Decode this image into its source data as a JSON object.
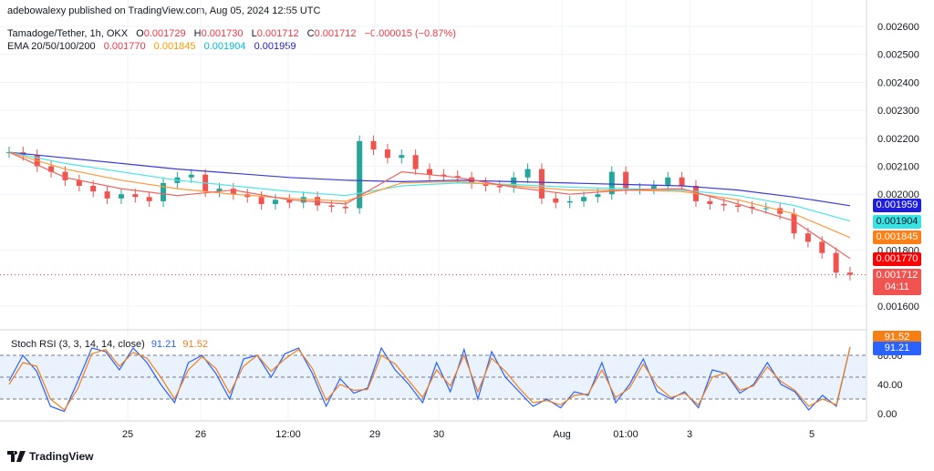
{
  "header": {
    "published": "adebowalexy published on TradingView.com, Aug 05, 2024 12:55 UTC",
    "symbol": "Tamadoge/Tether, 1h, OKX",
    "o_label": "O",
    "o": "0.001729",
    "h_label": "H",
    "h": "0.001730",
    "l_label": "L",
    "l": "0.001712",
    "c_label": "C",
    "c": "0.001712",
    "change": "−0.000015 (−0.87%)",
    "ema_label": "EMA 20/50/100/200",
    "ema20": "0.001770",
    "ema50": "0.001845",
    "ema100": "0.001904",
    "ema200": "0.001959"
  },
  "price_tags": {
    "ema200": "0.001959",
    "ema100": "0.001904",
    "ema50": "0.001845",
    "ema20": "0.001770",
    "last": "0.001712",
    "countdown": "04:11"
  },
  "rsi": {
    "title": "Stoch RSI (3, 3, 14, 14, close)",
    "k": "91.21",
    "d": "91.52",
    "tag_k": "91.21",
    "tag_d": "91.52"
  },
  "branding": "TradingView",
  "chart_data": [
    {
      "type": "candlestick",
      "title": "Tamadoge/Tether, 1h, OKX",
      "y_ticks": [
        "0.002600",
        "0.002500",
        "0.002400",
        "0.002300",
        "0.002200",
        "0.002100",
        "0.002000",
        "0.001800",
        "0.001600"
      ],
      "ylim": [
        0.00155,
        0.00264
      ],
      "x_ticks": [
        "25",
        "26",
        "12:00",
        "29",
        "30",
        "Aug",
        "01:00",
        "3",
        "5"
      ],
      "last_close": 0.001712,
      "series": [
        {
          "name": "EMA 200",
          "color": "#3b3bd8",
          "values": [
            0.00215,
            0.00213,
            0.00211,
            0.00209,
            0.002075,
            0.00206,
            0.00205,
            0.002045,
            0.00205,
            0.002045,
            0.00204,
            0.002035,
            0.00203,
            0.002015,
            0.00199,
            0.001959
          ]
        },
        {
          "name": "EMA 100",
          "color": "#4ee6e6",
          "values": [
            0.00215,
            0.00211,
            0.00208,
            0.00205,
            0.00203,
            0.00201,
            0.001995,
            0.00203,
            0.00204,
            0.002035,
            0.002025,
            0.00202,
            0.002015,
            0.001995,
            0.00196,
            0.001904
          ]
        },
        {
          "name": "EMA 50",
          "color": "#ff9a3c",
          "values": [
            0.00215,
            0.00209,
            0.00205,
            0.00202,
            0.002,
            0.001985,
            0.001975,
            0.00204,
            0.002045,
            0.00203,
            0.002015,
            0.002015,
            0.00201,
            0.00198,
            0.00193,
            0.001845
          ]
        },
        {
          "name": "EMA 20",
          "color": "#f0625d",
          "values": [
            0.00215,
            0.00206,
            0.00202,
            0.001995,
            0.002015,
            0.00198,
            0.001965,
            0.00208,
            0.00206,
            0.002025,
            0.002,
            0.002015,
            0.00202,
            0.001965,
            0.001905,
            0.00177
          ]
        }
      ],
      "closes": [
        0.00215,
        0.00214,
        0.0021,
        0.00208,
        0.00205,
        0.00203,
        0.00201,
        0.001985,
        0.002,
        0.00199,
        0.001975,
        0.00204,
        0.00206,
        0.00207,
        0.00201,
        0.00202,
        0.002,
        0.00199,
        0.001965,
        0.00198,
        0.00197,
        0.00199,
        0.00196,
        0.001955,
        0.00195,
        0.00219,
        0.00216,
        0.00213,
        0.00214,
        0.00209,
        0.00207,
        0.002065,
        0.00206,
        0.00204,
        0.00203,
        0.002025,
        0.00206,
        0.00209,
        0.001985,
        0.00197,
        0.001975,
        0.00199,
        0.002,
        0.00208,
        0.00202,
        0.00202,
        0.00203,
        0.00206,
        0.00203,
        0.001975,
        0.001965,
        0.00196,
        0.001955,
        0.00195,
        0.00195,
        0.00193,
        0.00186,
        0.00183,
        0.00179,
        0.00172,
        0.001712
      ]
    },
    {
      "type": "line",
      "title": "Stoch RSI (3, 3, 14, 14, close)",
      "y_ticks": [
        "80.00",
        "40.00",
        "0.00"
      ],
      "ylim": [
        -5,
        103
      ],
      "bands": [
        20,
        50,
        80
      ],
      "series": [
        {
          "name": "K",
          "color": "#2962ff",
          "values": [
            45,
            80,
            58,
            10,
            3,
            45,
            90,
            85,
            60,
            90,
            70,
            40,
            15,
            70,
            80,
            55,
            20,
            75,
            80,
            50,
            82,
            90,
            55,
            10,
            48,
            28,
            35,
            90,
            60,
            40,
            15,
            70,
            30,
            88,
            20,
            85,
            50,
            30,
            10,
            20,
            8,
            30,
            25,
            70,
            15,
            40,
            75,
            30,
            20,
            30,
            8,
            60,
            55,
            28,
            40,
            70,
            40,
            30,
            5,
            25,
            10,
            91.21
          ]
        },
        {
          "name": "D",
          "color": "#f57f17",
          "values": [
            40,
            70,
            65,
            20,
            5,
            35,
            82,
            88,
            65,
            84,
            76,
            50,
            20,
            60,
            78,
            62,
            28,
            65,
            80,
            58,
            75,
            88,
            62,
            18,
            40,
            32,
            33,
            80,
            68,
            45,
            22,
            60,
            38,
            80,
            30,
            76,
            58,
            35,
            15,
            18,
            12,
            25,
            27,
            60,
            22,
            35,
            68,
            38,
            22,
            28,
            12,
            50,
            56,
            32,
            38,
            64,
            44,
            32,
            10,
            20,
            12,
            91.52
          ]
        }
      ]
    }
  ]
}
